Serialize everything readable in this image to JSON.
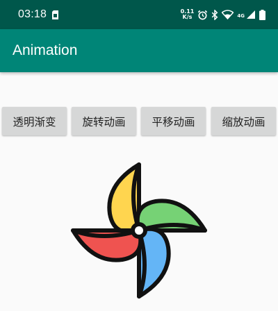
{
  "status_bar": {
    "time": "03:18",
    "net_speed_value": "0.11",
    "net_speed_unit": "K/s",
    "network_type": "4G",
    "icons": [
      "sim-card-icon",
      "alarm-icon",
      "bluetooth-icon",
      "wifi-icon",
      "cellular-signal-icon",
      "battery-icon"
    ]
  },
  "app_bar": {
    "title": "Animation"
  },
  "buttons": [
    {
      "label": "透明渐变"
    },
    {
      "label": "旋转动画"
    },
    {
      "label": "平移动画"
    },
    {
      "label": "缩放动画"
    }
  ],
  "colors": {
    "status_bar": "#00574b",
    "app_bar": "#008577",
    "button": "#d6d7d7",
    "background": "#fafafa",
    "blade_yellow": "#ffd54f",
    "blade_green": "#76d275",
    "blade_blue": "#64b5f6",
    "blade_red": "#ef5350"
  },
  "image": {
    "icon": "pinwheel-icon"
  }
}
